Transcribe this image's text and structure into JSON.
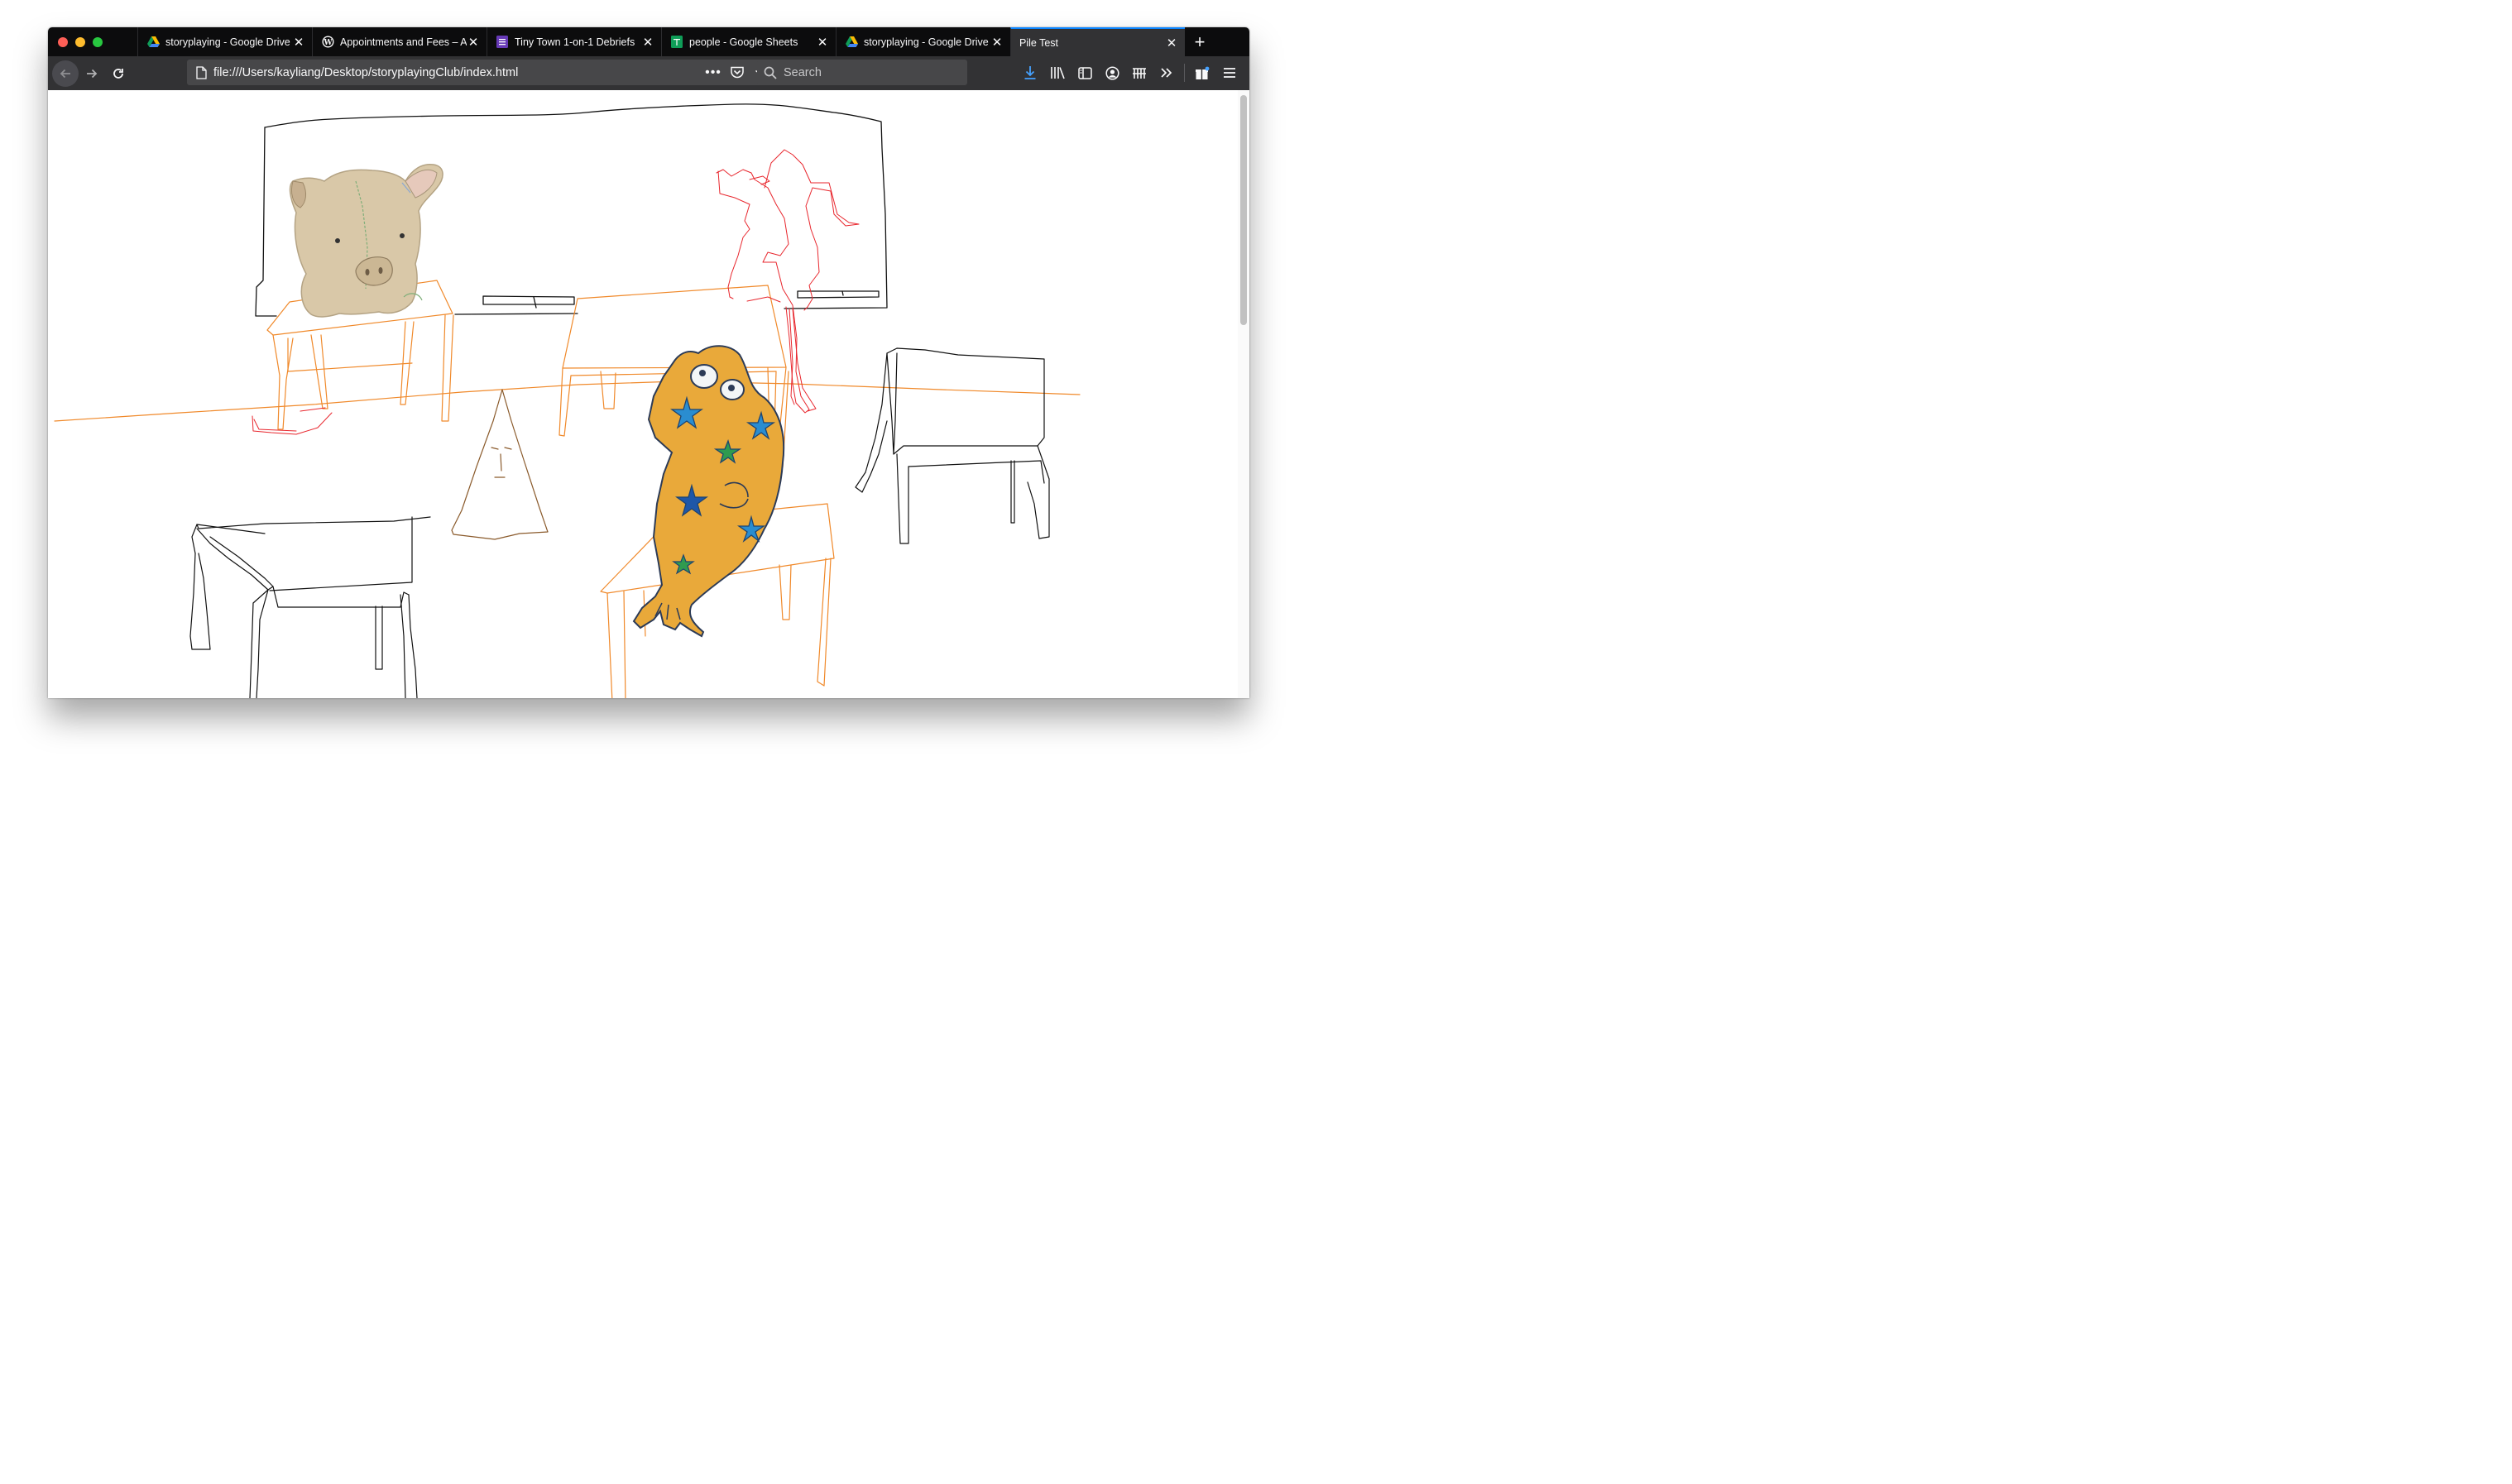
{
  "browser": {
    "tabs": [
      {
        "title": "storyplaying - Google Drive",
        "favicon": "google-drive-icon",
        "active": false
      },
      {
        "title": "Appointments and Fees – A",
        "favicon": "wordpress-icon",
        "active": false
      },
      {
        "title": "Tiny Town 1-on-1 Debriefs",
        "favicon": "google-forms-icon",
        "active": false
      },
      {
        "title": "people - Google Sheets",
        "favicon": "google-sheets-icon",
        "active": false
      },
      {
        "title": "storyplaying - Google Drive",
        "favicon": "google-drive-icon",
        "active": false
      },
      {
        "title": "Pile Test",
        "favicon": "",
        "active": true
      }
    ],
    "url": "file:///Users/kayliang/Desktop/storyplayingClub/index.html",
    "search_placeholder": "Search",
    "colors": {
      "tabstrip": "#0c0c0d",
      "toolbar": "#323234",
      "active_tab_accent": "#0a84ff",
      "download_icon": "#45a1ff"
    }
  },
  "page": {
    "scene": {
      "pig": "felt-pig-plush-image",
      "frog": "starry-yellow-frog-drawing",
      "cone": "cone-with-face-doodle",
      "figure": "red-outline-figure-drinking",
      "stroke_colors": {
        "desks": "#f0892a",
        "outline": "#111111",
        "figure": "#e8262d",
        "cone": "#8a5a2b"
      }
    }
  }
}
